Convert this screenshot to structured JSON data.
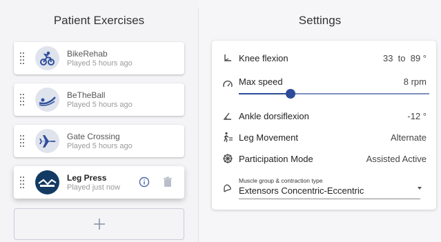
{
  "left_panel": {
    "title": "Patient Exercises",
    "exercises": [
      {
        "name": "BikeRehab",
        "played": "Played 5 hours ago",
        "icon": "bike-rider-icon"
      },
      {
        "name": "BeTheBall",
        "played": "Played 5 hours ago",
        "icon": "water-slide-icon"
      },
      {
        "name": "Gate Crossing",
        "played": "Played 5 hours ago",
        "icon": "airplane-icon"
      },
      {
        "name": "Leg Press",
        "played": "Played just now",
        "icon": "leg-press-icon"
      }
    ]
  },
  "settings": {
    "title": "Settings",
    "knee_flexion": {
      "label": "Knee flexion",
      "value": "33  to  89 °"
    },
    "max_speed": {
      "label": "Max speed",
      "value": "8 rpm",
      "slider_fraction": 0.27
    },
    "ankle": {
      "label": "Ankle dorsiflexion",
      "value": "-12 °"
    },
    "leg_movement": {
      "label": "Leg Movement",
      "value": "Alternate"
    },
    "participation": {
      "label": "Participation Mode",
      "value": "Assisted Active"
    },
    "muscle": {
      "label": "Muscle group & contraction type",
      "value": "Extensors Concentric-Eccentric"
    }
  },
  "colors": {
    "accent": "#2e4b9a",
    "avatar_bg": "#dfe3ec",
    "avatar_dark": "#123a63"
  }
}
